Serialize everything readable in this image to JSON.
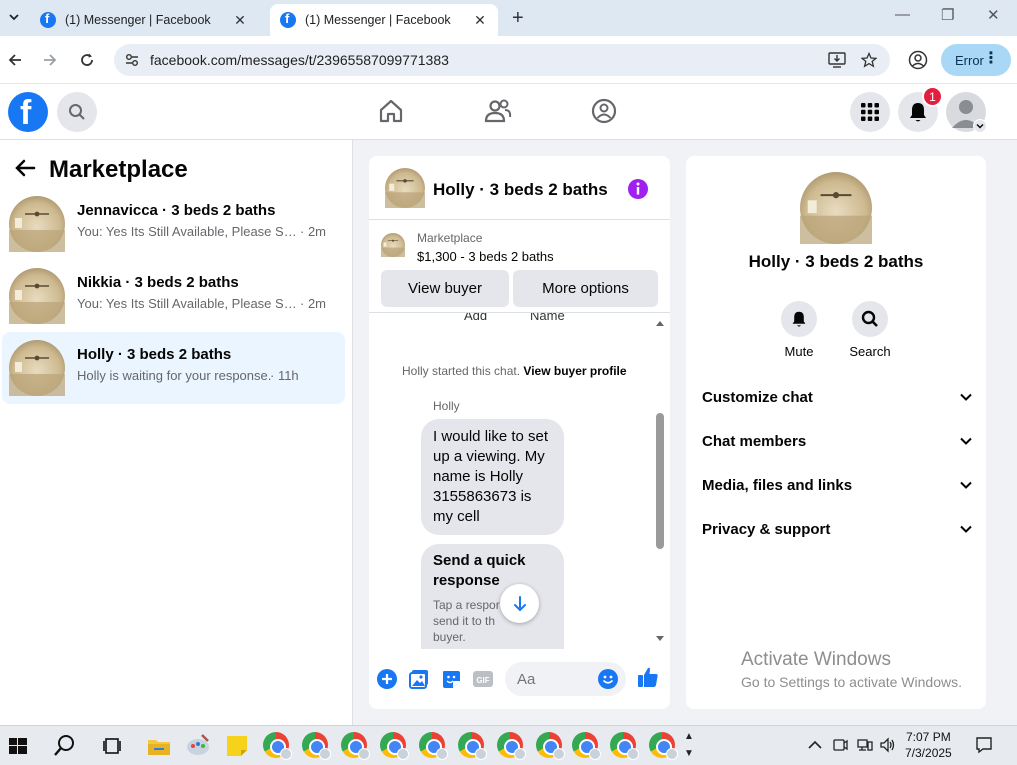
{
  "browser": {
    "tabs": [
      {
        "title": "(1) Messenger | Facebook",
        "active": false
      },
      {
        "title": "(1) Messenger | Facebook",
        "active": true
      }
    ],
    "url": "facebook.com/messages/t/23965587099771383",
    "profile_button_label": "Error"
  },
  "header": {
    "notification_count": "1"
  },
  "sidebar": {
    "title": "Marketplace",
    "conversations": [
      {
        "name": "Jennavicca · 3 beds 2 baths",
        "preview": "You: Yes Its Still Available, Please Sen...",
        "time": "· 2m"
      },
      {
        "name": "Nikkia · 3 beds 2 baths",
        "preview": "You: Yes Its Still Available, Please Sen...",
        "time": "· 2m"
      },
      {
        "name": "Holly · 3 beds 2 baths",
        "preview": "Holly is waiting for your response.",
        "time": "· 11h"
      }
    ]
  },
  "chat": {
    "title": "Holly · 3 beds 2 baths",
    "listing_label": "Marketplace",
    "listing_price": "$1,300 - 3 beds 2 baths",
    "view_buyer_label": "View buyer",
    "more_options_label": "More options",
    "clipped_labels": [
      "Add",
      "Name"
    ],
    "started_text": "Holly started this chat.",
    "view_profile_link": "View buyer profile",
    "sender_name": "Holly",
    "message": "I would like to set up a viewing. My name is Holly 3155863673 is my cell",
    "quick_response_title": "Send a quick response",
    "quick_response_desc": "Tap a respor send it to th buyer.",
    "composer_placeholder": "Aa"
  },
  "details": {
    "title": "Holly · 3 beds 2 baths",
    "actions": [
      {
        "label": "Mute",
        "icon": "bell-icon"
      },
      {
        "label": "Search",
        "icon": "search-icon"
      }
    ],
    "sections": [
      "Customize chat",
      "Chat members",
      "Media, files and links",
      "Privacy & support"
    ]
  },
  "watermark": {
    "line1": "Activate Windows",
    "line2": "Go to Settings to activate Windows."
  },
  "taskbar": {
    "time": "7:07 PM",
    "date": "7/3/2025"
  },
  "colors": {
    "brand": "#1877f2",
    "selected_row": "#ebf5ff",
    "badge": "#e41e3f",
    "info_purple": "#a020f0"
  }
}
